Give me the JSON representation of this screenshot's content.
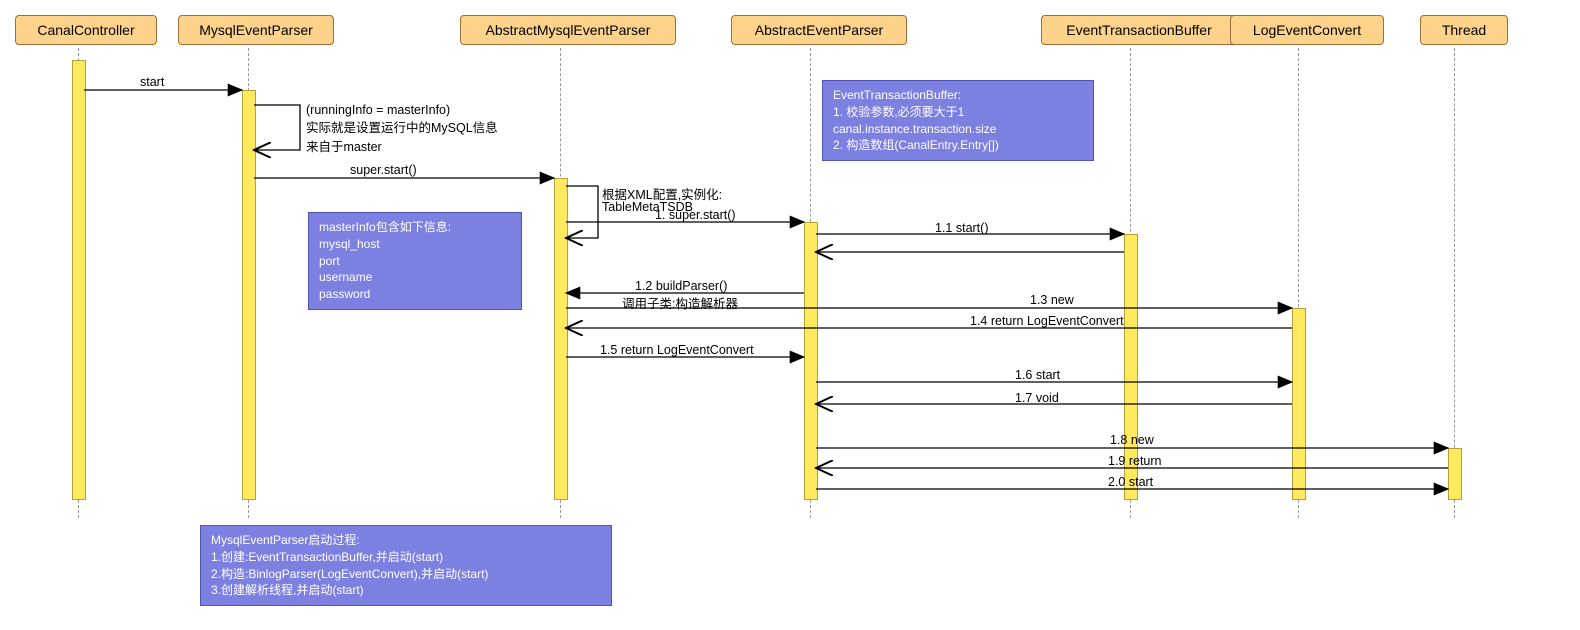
{
  "participants": {
    "p0": "CanalController",
    "p1": "MysqlEventParser",
    "p2": "AbstractMysqlEventParser",
    "p3": "AbstractEventParser",
    "p4": "EventTransactionBuffer",
    "p5": "LogEventConvert",
    "p6": "Thread"
  },
  "messages": {
    "m_start": "start",
    "m_self1": "(runningInfo = masterInfo)\n实际就是设置运行中的MySQL信息\n来自于master",
    "m_super1": "super.start()",
    "m_self2_1": "根据XML配置,实例化:",
    "m_self2_2": "TableMetaTSDB",
    "m_1": "1. super.start()",
    "m_1_1": "1.1 start()",
    "m_1_2": "1.2 buildParser()",
    "m_1_2b": "调用子类:构造解析器",
    "m_1_3": "1.3 new",
    "m_1_4": "1.4 return LogEventConvert",
    "m_1_5": "1.5 return LogEventConvert",
    "m_1_6": "1.6 start",
    "m_1_7": "1.7 void",
    "m_1_8": "1.8 new",
    "m_1_9": "1.9 return",
    "m_2_0": "2.0 start"
  },
  "notes": {
    "n1_line1": "EventTransactionBuffer:",
    "n1_line2": "1. 校验参数,必须要大于1",
    "n1_line3": "    canal.instance.transaction.size",
    "n1_line4": "2. 构造数组(CanalEntry.Entry[])",
    "n2_line1": "masterInfo包含如下信息:",
    "n2_line2": "    mysql_host",
    "n2_line3": "    port",
    "n2_line4": "    username",
    "n2_line5": "    password",
    "n3_line1": "MysqlEventParser启动过程:",
    "n3_line2": "1.创建:EventTransactionBuffer,并启动(start)",
    "n3_line3": "2.构造:BinlogParser(LogEventConvert),并启动(start)",
    "n3_line4": "3.创建解析线程,并启动(start)"
  }
}
